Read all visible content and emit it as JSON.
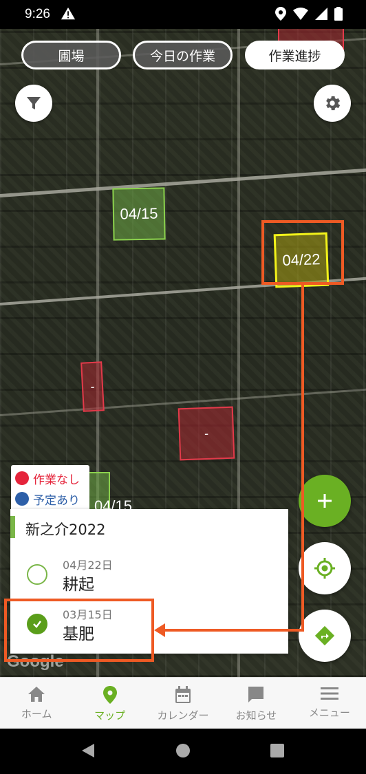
{
  "status_bar": {
    "time": "9:26"
  },
  "tabs": [
    {
      "label": "圃場",
      "active": false
    },
    {
      "label": "今日の作業",
      "active": false
    },
    {
      "label": "作業進捗",
      "active": true
    }
  ],
  "fields": [
    {
      "label": "04/15",
      "status": "green"
    },
    {
      "label": "04/22",
      "status": "yellow"
    },
    {
      "label": "-",
      "status": "red"
    },
    {
      "label": "-",
      "status": "red"
    },
    {
      "label": "04/15",
      "status": "green"
    }
  ],
  "legend": {
    "items": [
      {
        "label": "作業なし",
        "color": "#e5243b"
      },
      {
        "label": "予定あり",
        "color": "#2d5fa8"
      }
    ]
  },
  "card": {
    "title": "新之介2022",
    "tasks": [
      {
        "date": "04月22日",
        "name": "耕起",
        "done": false
      },
      {
        "date": "03月15日",
        "name": "基肥",
        "done": true
      }
    ]
  },
  "map_attribution": "Google",
  "bottom_nav": [
    {
      "label": "ホーム",
      "icon": "home-icon",
      "active": false
    },
    {
      "label": "マップ",
      "icon": "map-pin-icon",
      "active": true
    },
    {
      "label": "カレンダー",
      "icon": "calendar-icon",
      "active": false
    },
    {
      "label": "お知らせ",
      "icon": "message-icon",
      "active": false
    },
    {
      "label": "メニュー",
      "icon": "menu-icon",
      "active": false
    }
  ],
  "colors": {
    "accent": "#6ab023",
    "annotation": "#ee5a24",
    "field_green": "#8bd14d",
    "field_yellow": "#f2f21a",
    "field_red": "#e23a4a"
  }
}
